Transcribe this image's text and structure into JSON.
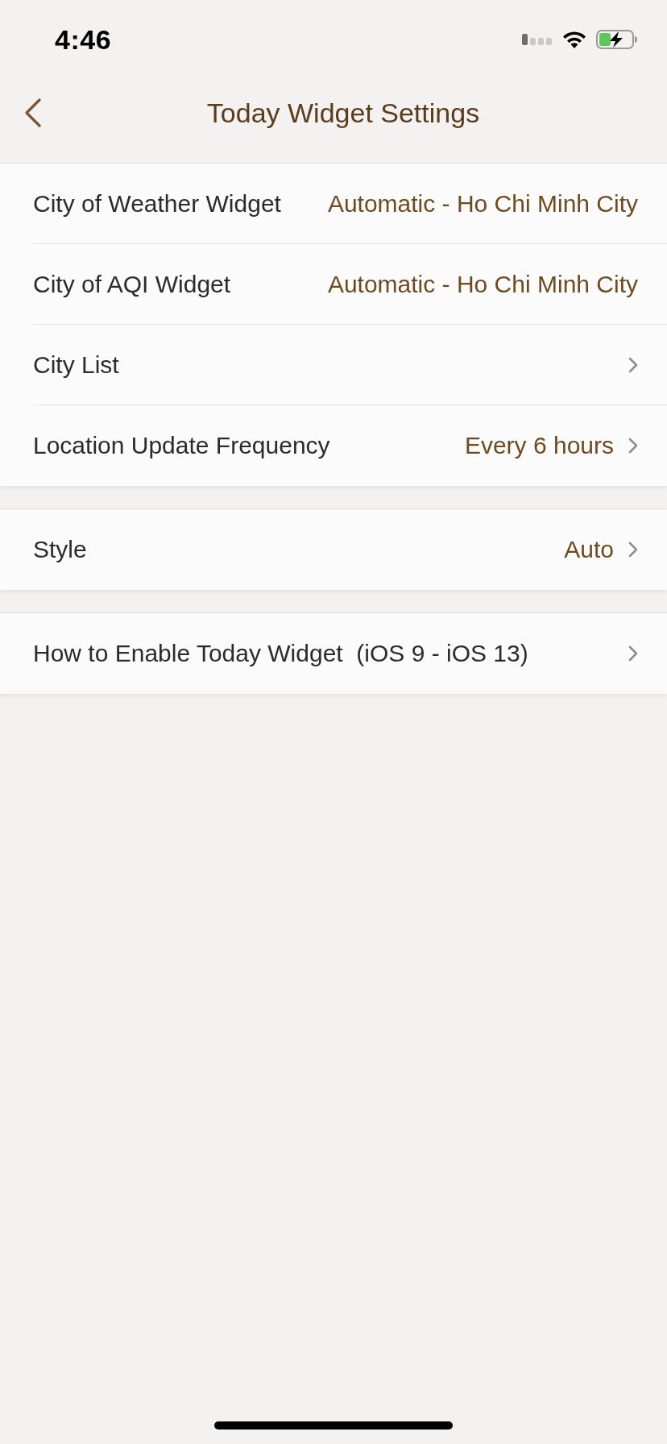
{
  "status_bar": {
    "time": "4:46"
  },
  "nav_bar": {
    "title": "Today Widget Settings"
  },
  "groups": [
    {
      "rows": [
        {
          "label": "City of Weather Widget",
          "value": "Automatic - Ho Chi Minh City",
          "disclosure": false
        },
        {
          "label": "City of AQI Widget",
          "value": "Automatic - Ho Chi Minh City",
          "disclosure": false
        },
        {
          "label": "City List",
          "disclosure": true
        },
        {
          "label": "Location Update Frequency",
          "value": "Every 6 hours",
          "disclosure": true
        }
      ]
    },
    {
      "rows": [
        {
          "label": "Style",
          "value": "Auto",
          "disclosure": true
        }
      ]
    },
    {
      "rows": [
        {
          "label": "How to Enable Today Widget  (iOS 9 - iOS 13)",
          "disclosure": true
        }
      ]
    }
  ]
}
